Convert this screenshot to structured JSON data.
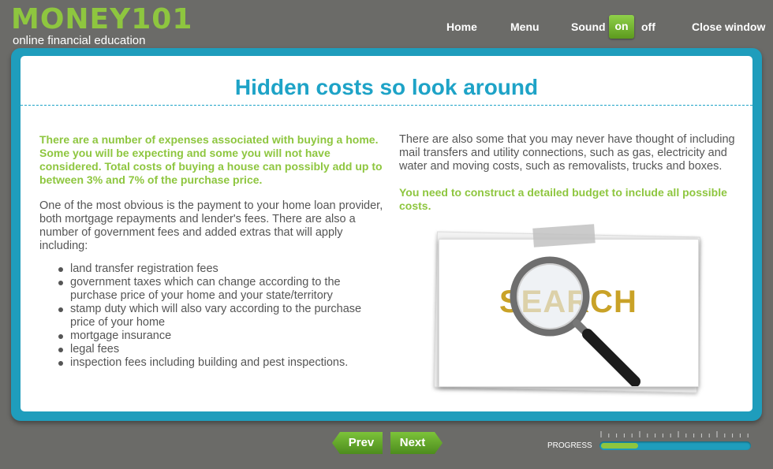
{
  "header": {
    "logo_text": "MONEY101",
    "logo_sub": "online financial education",
    "nav": {
      "home": "Home",
      "menu": "Menu",
      "sound_label": "Sound",
      "sound_on": "on",
      "sound_off": "off",
      "close": "Close window"
    }
  },
  "page": {
    "title": "Hidden costs so look around",
    "left": {
      "lead": "There are a number of expenses associated with buying a home. Some you will be expecting and some you will not have considered. Total costs of buying a house can possibly add up to between 3% and 7% of the purchase price.",
      "body": "One of the most obvious is the payment to your home loan provider, both mortgage repayments and lender's fees. There are also a number of government fees and added extras that will apply including:",
      "items": [
        "land transfer registration fees",
        "government taxes which can change according to the purchase price of your home and your state/territory",
        "stamp duty which will also vary according to the purchase price of your home",
        "mortgage insurance",
        "legal fees",
        "inspection fees including building and pest inspections."
      ]
    },
    "right": {
      "body": "There are also some that you may never have thought of including mail transfers and utility connections, such as gas, electricity and water and moving costs, such as removalists, trucks and boxes.",
      "lead": "You need to construct a detailed budget to include all possible costs.",
      "image_text": "SEARCH"
    }
  },
  "footer": {
    "prev": "Prev",
    "next": "Next",
    "progress_label": "PROGRESS",
    "progress_fraction": 0.25
  },
  "colors": {
    "brand_green": "#8ec63f",
    "accent_blue": "#1ea3c7",
    "background": "#6b6b68"
  }
}
